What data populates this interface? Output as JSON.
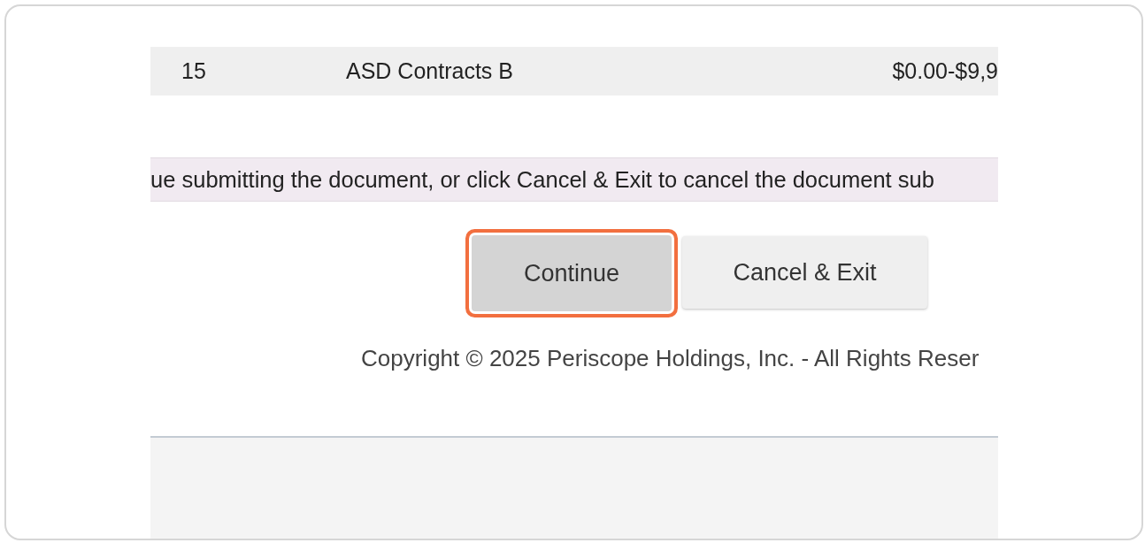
{
  "table": {
    "rows": [
      {
        "number": "15",
        "name": "ASD Contracts B",
        "range": "$0.00-$9,9"
      }
    ]
  },
  "message": "ue submitting the document, or click Cancel & Exit to cancel the document sub",
  "buttons": [
    {
      "label": "Continue",
      "focused": true
    },
    {
      "label": "Cancel & Exit",
      "focused": false
    }
  ],
  "copyright": "Copyright © 2025 Periscope Holdings, Inc. - All Rights Reser"
}
